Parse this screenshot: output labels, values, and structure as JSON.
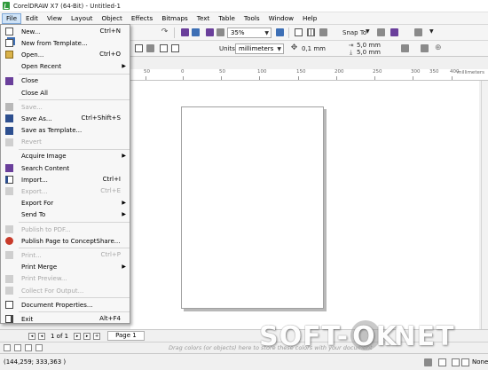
{
  "window": {
    "title": "CorelDRAW X7 (64-Bit) - Untitled-1"
  },
  "menubar": [
    "File",
    "Edit",
    "View",
    "Layout",
    "Object",
    "Effects",
    "Bitmaps",
    "Text",
    "Table",
    "Tools",
    "Window",
    "Help"
  ],
  "toolbar": {
    "zoom": "35%",
    "snap_to": "Snap To"
  },
  "propbar": {
    "units_label": "Units:",
    "units_value": "millimeters",
    "nudge": "0,1 mm",
    "dup_x": "5,0 mm",
    "dup_y": "5,0 mm"
  },
  "ruler": {
    "ticks": [
      "50",
      "0",
      "50",
      "100",
      "150",
      "200",
      "250",
      "300",
      "350",
      "400"
    ],
    "unit": "millimeters"
  },
  "file_menu": [
    {
      "label": "New...",
      "shortcut": "Ctrl+N",
      "icon": "new-document-icon",
      "enabled": true
    },
    {
      "label": "New from Template...",
      "icon": "template-icon",
      "enabled": true
    },
    {
      "label": "Open...",
      "shortcut": "Ctrl+O",
      "icon": "open-folder-icon",
      "enabled": true
    },
    {
      "label": "Open Recent",
      "submenu": true,
      "enabled": true
    },
    {
      "sep": true
    },
    {
      "label": "Close",
      "icon": "close-document-icon",
      "enabled": true
    },
    {
      "label": "Close All",
      "enabled": true
    },
    {
      "sep": true
    },
    {
      "label": "Save...",
      "icon": "save-icon",
      "enabled": false
    },
    {
      "label": "Save As...",
      "shortcut": "Ctrl+Shift+S",
      "icon": "save-as-icon",
      "enabled": true
    },
    {
      "label": "Save as Template...",
      "icon": "save-template-icon",
      "enabled": true
    },
    {
      "label": "Revert",
      "icon": "revert-icon",
      "enabled": false
    },
    {
      "sep": true
    },
    {
      "label": "Acquire Image",
      "submenu": true,
      "enabled": true
    },
    {
      "label": "Search Content",
      "icon": "search-content-icon",
      "enabled": true
    },
    {
      "label": "Import...",
      "shortcut": "Ctrl+I",
      "icon": "import-icon",
      "enabled": true
    },
    {
      "label": "Export...",
      "shortcut": "Ctrl+E",
      "icon": "export-icon",
      "enabled": false
    },
    {
      "label": "Export For",
      "submenu": true,
      "enabled": true
    },
    {
      "label": "Send To",
      "submenu": true,
      "enabled": true
    },
    {
      "sep": true
    },
    {
      "label": "Publish to PDF...",
      "icon": "pdf-icon",
      "enabled": false
    },
    {
      "label": "Publish Page to ConceptShare...",
      "icon": "conceptshare-icon",
      "enabled": true
    },
    {
      "sep": true
    },
    {
      "label": "Print...",
      "shortcut": "Ctrl+P",
      "icon": "print-icon",
      "enabled": false
    },
    {
      "label": "Print Merge",
      "submenu": true,
      "enabled": true
    },
    {
      "label": "Print Preview...",
      "icon": "print-preview-icon",
      "enabled": false
    },
    {
      "label": "Collect For Output...",
      "icon": "collect-output-icon",
      "enabled": false
    },
    {
      "sep": true
    },
    {
      "label": "Document Properties...",
      "icon": "document-properties-icon",
      "enabled": true
    },
    {
      "sep": true
    },
    {
      "label": "Exit",
      "shortcut": "Alt+F4",
      "icon": "exit-icon",
      "enabled": true
    }
  ],
  "pagenav": {
    "counter": "1 of 1",
    "tab": "Page 1"
  },
  "palette": {
    "hint": "Drag colors (or objects) here to store these colors with your document"
  },
  "status": {
    "coords": "(144,259; 333,363 )",
    "fill": "None"
  },
  "watermark": {
    "left": "SOFT-",
    "right": "NET",
    "dot_text": "OK"
  }
}
